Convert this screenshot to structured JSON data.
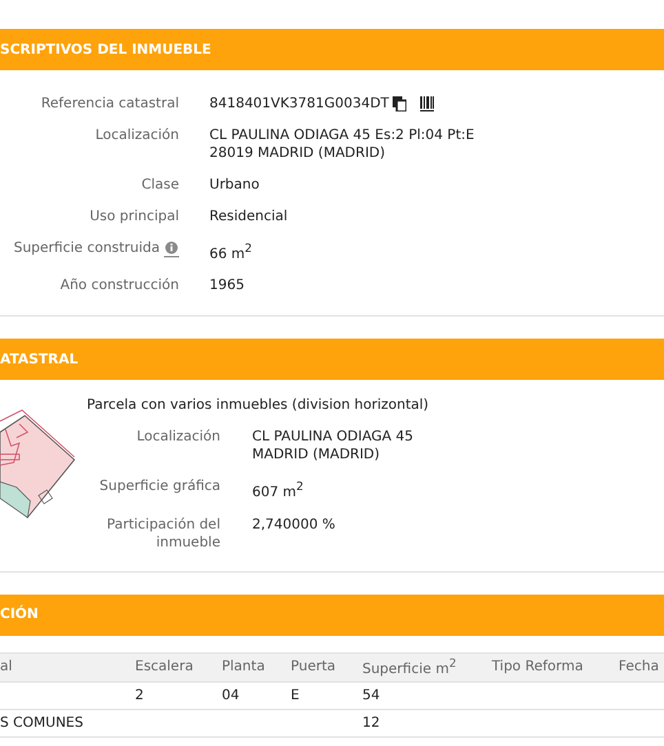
{
  "property": {
    "title": "SCRIPTIVOS DEL INMUEBLE",
    "fields": [
      {
        "label": "Referencia catastral",
        "lines": [
          "8418401VK3781G0034DT"
        ],
        "kind": "reference"
      },
      {
        "label": "Localización",
        "lines": [
          "CL PAULINA ODIAGA 45 Es:2 Pl:04 Pt:E",
          "28019 MADRID (MADRID)"
        ],
        "kind": "plain"
      },
      {
        "label": "Clase",
        "lines": [
          "Urbano"
        ],
        "kind": "plain"
      },
      {
        "label": "Uso principal",
        "lines": [
          "Residencial"
        ],
        "kind": "plain"
      },
      {
        "label": "Superficie construida",
        "lines": [
          "66 m$^{2}$"
        ],
        "kind": "help"
      },
      {
        "label": "Año construcción",
        "lines": [
          "1965"
        ],
        "kind": "plain"
      }
    ]
  },
  "parcel": {
    "title": "ATASTRAL",
    "description": "Parcela con varios inmuebles (division horizontal)",
    "fields": [
      {
        "label": [
          "Localización"
        ],
        "lines": [
          "CL PAULINA ODIAGA 45",
          "MADRID (MADRID)"
        ]
      },
      {
        "label": [
          "Superficie gráfica"
        ],
        "lines": [
          "607 m$^{2}$"
        ]
      },
      {
        "label": [
          "Participación del",
          "inmueble"
        ],
        "lines": [
          "2,740000 %"
        ]
      }
    ]
  },
  "construction": {
    "title": "CIÓN",
    "table": {
      "columns": [
        "al",
        "Escalera",
        "Planta",
        "Puerta",
        "Superficie m$^{2}$",
        "Tipo Reforma",
        "Fecha"
      ],
      "rows": [
        [
          "",
          "2",
          "04",
          "E",
          "54",
          "",
          ""
        ],
        [
          "S COMUNES",
          "",
          "",
          "",
          "12",
          "",
          ""
        ]
      ]
    }
  }
}
